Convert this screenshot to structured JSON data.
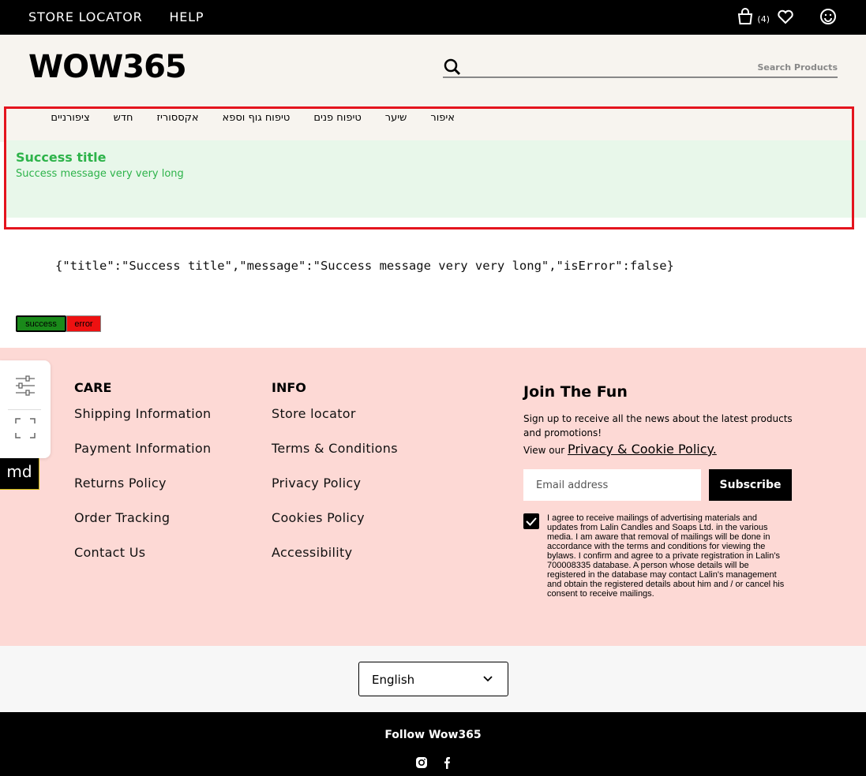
{
  "topbar": {
    "store_locator": "STORE LOCATOR",
    "help": "HELP",
    "cart_count": "(4)",
    "icons": [
      "bag-icon",
      "heart-icon",
      "smile-icon"
    ]
  },
  "header": {
    "logo": "WOW365",
    "search_placeholder": "Search Products"
  },
  "nav": {
    "items": [
      "איפור",
      "שיער",
      "טיפוח פנים",
      "טיפוח גוף וספא",
      "אקססוריז",
      "חדש",
      "ציפורניים"
    ]
  },
  "toast": {
    "title": "Success title",
    "message": "Success message very very long",
    "background": "#e8f7ea",
    "text_color": "#2db34a"
  },
  "debug": {
    "json_text": "{\"title\":\"Success title\",\"message\":\"Success message very very long\",\"isError\":false}",
    "success_label": "success",
    "error_label": "error"
  },
  "side_tools": {
    "badge": "md"
  },
  "footer": {
    "background": "#fdd9d5",
    "care": {
      "heading": "CARE",
      "links": [
        "Shipping Information",
        "Payment Information",
        "Returns Policy",
        "Order Tracking",
        "Contact Us"
      ]
    },
    "info": {
      "heading": "INFO",
      "links": [
        "Store locator",
        "Terms & Conditions",
        "Privacy Policy",
        "Cookies Policy",
        "Accessibility"
      ]
    },
    "join": {
      "heading": "Join The Fun",
      "text": "Sign up to receive all the news about the latest products and promotions!",
      "view_prefix": "View our",
      "policy_link": "Privacy & Cookie Policy.",
      "email_placeholder": "Email address",
      "subscribe": "Subscribe",
      "consent_checked": true,
      "consent_text": "I agree to receive mailings of advertising materials and updates from Lalin Candles and Soaps Ltd. in the various media. I am aware that removal of mailings will be done in accordance with the terms and conditions for viewing the bylaws. I confirm and agree to a private registration in Lalin's 700008335 database. A person whose details will be registered in the database may contact Lalin's management and obtain the registered details about him and / or cancel his consent to receive mailings."
    }
  },
  "language": {
    "selected": "English"
  },
  "bottom": {
    "follow": "Follow Wow365",
    "social_icons": [
      "instagram-icon",
      "facebook-icon"
    ]
  }
}
